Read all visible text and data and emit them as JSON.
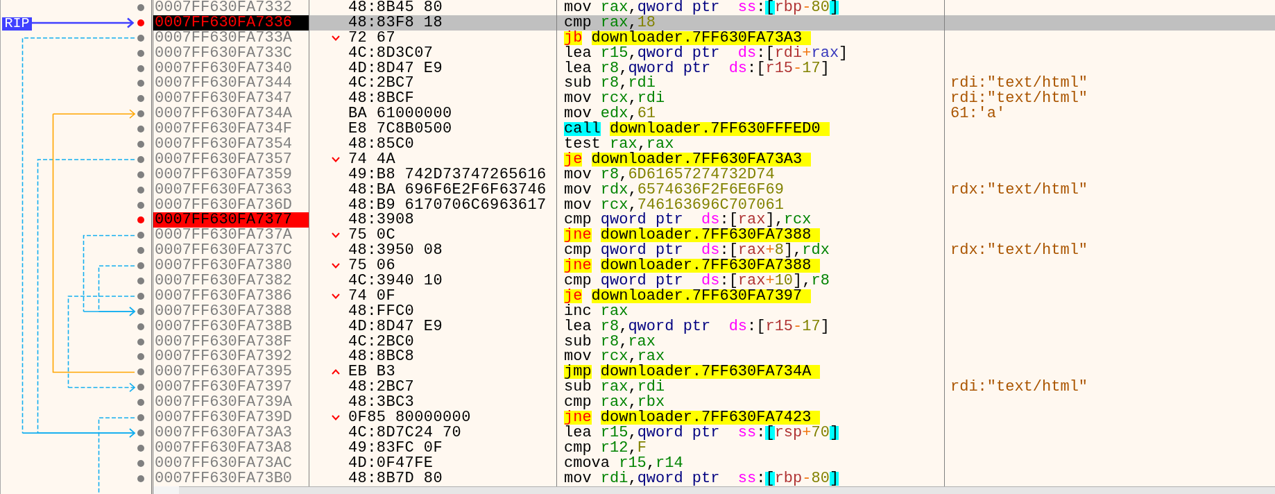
{
  "gutter": {
    "pointer_label": "RIP"
  },
  "rows": [
    {
      "kind": "plain",
      "address": "0007FF630FA7332",
      "breakpoint": false,
      "current": false,
      "selected": false,
      "bytes": "48:8B45 80",
      "mnemonic": {
        "kind": "plain",
        "text": "mov"
      },
      "operands": [
        {
          "kind": "reg",
          "text": "rax"
        },
        {
          "kind": "punct",
          "text": ","
        },
        {
          "kind": "size",
          "text": "qword ptr"
        },
        {
          "kind": "seg",
          "text": "ss"
        },
        {
          "kind": "punct",
          "text": ":"
        },
        {
          "kind": "stack-bracket",
          "text": "["
        },
        {
          "kind": "base",
          "text": "rbp"
        },
        {
          "kind": "op",
          "text": "-"
        },
        {
          "kind": "value",
          "text": "80"
        },
        {
          "kind": "stack-bracket",
          "text": "]"
        }
      ]
    },
    {
      "kind": "plain",
      "address": "0007FF630FA7336",
      "breakpoint": true,
      "current": true,
      "selected": true,
      "bytes": "48:83F8 18",
      "mnemonic": {
        "kind": "plain",
        "text": "cmp"
      },
      "operands": [
        {
          "kind": "reg",
          "text": "rax"
        },
        {
          "kind": "punct",
          "text": ","
        },
        {
          "kind": "value",
          "text": "18"
        }
      ]
    },
    {
      "kind": "branch-down",
      "address": "0007FF630FA733A",
      "breakpoint": false,
      "current": false,
      "selected": false,
      "bytes": "72 67",
      "mnemonic": {
        "kind": "cond-jump",
        "text": "jb"
      },
      "operands": [
        {
          "kind": "target",
          "text": "downloader.7FF630FA73A3"
        }
      ]
    },
    {
      "kind": "plain",
      "address": "0007FF630FA733C",
      "breakpoint": false,
      "current": false,
      "selected": false,
      "bytes": "4C:8D3C07",
      "mnemonic": {
        "kind": "plain",
        "text": "lea"
      },
      "operands": [
        {
          "kind": "reg",
          "text": "r15"
        },
        {
          "kind": "punct",
          "text": ","
        },
        {
          "kind": "size",
          "text": "qword ptr"
        },
        {
          "kind": "seg",
          "text": "ds"
        },
        {
          "kind": "punct",
          "text": ":"
        },
        {
          "kind": "bracket",
          "text": "["
        },
        {
          "kind": "base",
          "text": "rdi"
        },
        {
          "kind": "op",
          "text": "+"
        },
        {
          "kind": "index",
          "text": "rax"
        },
        {
          "kind": "bracket",
          "text": "]"
        }
      ]
    },
    {
      "kind": "plain",
      "address": "0007FF630FA7340",
      "breakpoint": false,
      "current": false,
      "selected": false,
      "bytes": "4D:8D47 E9",
      "mnemonic": {
        "kind": "plain",
        "text": "lea"
      },
      "operands": [
        {
          "kind": "reg",
          "text": "r8"
        },
        {
          "kind": "punct",
          "text": ","
        },
        {
          "kind": "size",
          "text": "qword ptr"
        },
        {
          "kind": "seg",
          "text": "ds"
        },
        {
          "kind": "punct",
          "text": ":"
        },
        {
          "kind": "bracket",
          "text": "["
        },
        {
          "kind": "base",
          "text": "r15"
        },
        {
          "kind": "op",
          "text": "-"
        },
        {
          "kind": "value",
          "text": "17"
        },
        {
          "kind": "bracket",
          "text": "]"
        }
      ]
    },
    {
      "kind": "plain",
      "address": "0007FF630FA7344",
      "breakpoint": false,
      "current": false,
      "selected": false,
      "bytes": "4C:2BC7",
      "mnemonic": {
        "kind": "plain",
        "text": "sub"
      },
      "operands": [
        {
          "kind": "reg",
          "text": "r8"
        },
        {
          "kind": "punct",
          "text": ","
        },
        {
          "kind": "reg",
          "text": "rdi"
        }
      ],
      "comment": "rdi:\"text/html\""
    },
    {
      "kind": "plain",
      "address": "0007FF630FA7347",
      "breakpoint": false,
      "current": false,
      "selected": false,
      "bytes": "48:8BCF",
      "mnemonic": {
        "kind": "plain",
        "text": "mov"
      },
      "operands": [
        {
          "kind": "reg",
          "text": "rcx"
        },
        {
          "kind": "punct",
          "text": ","
        },
        {
          "kind": "reg",
          "text": "rdi"
        }
      ],
      "comment": "rdi:\"text/html\""
    },
    {
      "kind": "plain",
      "address": "0007FF630FA734A",
      "breakpoint": false,
      "current": false,
      "selected": false,
      "bytes": "BA 61000000",
      "mnemonic": {
        "kind": "plain",
        "text": "mov"
      },
      "operands": [
        {
          "kind": "reg",
          "text": "edx"
        },
        {
          "kind": "punct",
          "text": ","
        },
        {
          "kind": "value",
          "text": "61"
        }
      ],
      "comment": "61:'a'"
    },
    {
      "kind": "plain",
      "address": "0007FF630FA734F",
      "breakpoint": false,
      "current": false,
      "selected": false,
      "bytes": "E8 7C8B0500",
      "mnemonic": {
        "kind": "call",
        "text": "call"
      },
      "operands": [
        {
          "kind": "target",
          "text": "downloader.7FF630FFFED0"
        }
      ]
    },
    {
      "kind": "plain",
      "address": "0007FF630FA7354",
      "breakpoint": false,
      "current": false,
      "selected": false,
      "bytes": "48:85C0",
      "mnemonic": {
        "kind": "plain",
        "text": "test"
      },
      "operands": [
        {
          "kind": "reg",
          "text": "rax"
        },
        {
          "kind": "punct",
          "text": ","
        },
        {
          "kind": "reg",
          "text": "rax"
        }
      ]
    },
    {
      "kind": "branch-down",
      "address": "0007FF630FA7357",
      "breakpoint": false,
      "current": false,
      "selected": false,
      "bytes": "74 4A",
      "mnemonic": {
        "kind": "cond-jump",
        "text": "je"
      },
      "operands": [
        {
          "kind": "target",
          "text": "downloader.7FF630FA73A3"
        }
      ]
    },
    {
      "kind": "plain",
      "address": "0007FF630FA7359",
      "breakpoint": false,
      "current": false,
      "selected": false,
      "bytes": "49:B8 742D73747265616",
      "mnemonic": {
        "kind": "plain",
        "text": "mov"
      },
      "operands": [
        {
          "kind": "reg",
          "text": "r8"
        },
        {
          "kind": "punct",
          "text": ","
        },
        {
          "kind": "value",
          "text": "6D61657274732D74"
        }
      ]
    },
    {
      "kind": "plain",
      "address": "0007FF630FA7363",
      "breakpoint": false,
      "current": false,
      "selected": false,
      "bytes": "48:BA 696F6E2F6F63746",
      "mnemonic": {
        "kind": "plain",
        "text": "mov"
      },
      "operands": [
        {
          "kind": "reg",
          "text": "rdx"
        },
        {
          "kind": "punct",
          "text": ","
        },
        {
          "kind": "value",
          "text": "6574636F2F6E6F69"
        }
      ],
      "comment": "rdx:\"text/html\""
    },
    {
      "kind": "plain",
      "address": "0007FF630FA736D",
      "breakpoint": false,
      "current": false,
      "selected": false,
      "bytes": "48:B9 6170706C6963617",
      "mnemonic": {
        "kind": "plain",
        "text": "mov"
      },
      "operands": [
        {
          "kind": "reg",
          "text": "rcx"
        },
        {
          "kind": "punct",
          "text": ","
        },
        {
          "kind": "value",
          "text": "746163696C707061"
        }
      ]
    },
    {
      "kind": "plain",
      "address": "0007FF630FA7377",
      "breakpoint": true,
      "current": false,
      "selected": false,
      "bytes": "48:3908",
      "mnemonic": {
        "kind": "plain",
        "text": "cmp"
      },
      "operands": [
        {
          "kind": "size",
          "text": "qword ptr"
        },
        {
          "kind": "seg",
          "text": "ds"
        },
        {
          "kind": "punct",
          "text": ":"
        },
        {
          "kind": "bracket",
          "text": "["
        },
        {
          "kind": "base",
          "text": "rax"
        },
        {
          "kind": "bracket",
          "text": "]"
        },
        {
          "kind": "punct",
          "text": ","
        },
        {
          "kind": "reg",
          "text": "rcx"
        }
      ]
    },
    {
      "kind": "branch-down",
      "address": "0007FF630FA737A",
      "breakpoint": false,
      "current": false,
      "selected": false,
      "bytes": "75 0C",
      "mnemonic": {
        "kind": "cond-jump",
        "text": "jne"
      },
      "operands": [
        {
          "kind": "target",
          "text": "downloader.7FF630FA7388"
        }
      ]
    },
    {
      "kind": "plain",
      "address": "0007FF630FA737C",
      "breakpoint": false,
      "current": false,
      "selected": false,
      "bytes": "48:3950 08",
      "mnemonic": {
        "kind": "plain",
        "text": "cmp"
      },
      "operands": [
        {
          "kind": "size",
          "text": "qword ptr"
        },
        {
          "kind": "seg",
          "text": "ds"
        },
        {
          "kind": "punct",
          "text": ":"
        },
        {
          "kind": "bracket",
          "text": "["
        },
        {
          "kind": "base",
          "text": "rax"
        },
        {
          "kind": "op",
          "text": "+"
        },
        {
          "kind": "value",
          "text": "8"
        },
        {
          "kind": "bracket",
          "text": "]"
        },
        {
          "kind": "punct",
          "text": ","
        },
        {
          "kind": "reg",
          "text": "rdx"
        }
      ],
      "comment": "rdx:\"text/html\""
    },
    {
      "kind": "branch-down",
      "address": "0007FF630FA7380",
      "breakpoint": false,
      "current": false,
      "selected": false,
      "bytes": "75 06",
      "mnemonic": {
        "kind": "cond-jump",
        "text": "jne"
      },
      "operands": [
        {
          "kind": "target",
          "text": "downloader.7FF630FA7388"
        }
      ]
    },
    {
      "kind": "plain",
      "address": "0007FF630FA7382",
      "breakpoint": false,
      "current": false,
      "selected": false,
      "bytes": "4C:3940 10",
      "mnemonic": {
        "kind": "plain",
        "text": "cmp"
      },
      "operands": [
        {
          "kind": "size",
          "text": "qword ptr"
        },
        {
          "kind": "seg",
          "text": "ds"
        },
        {
          "kind": "punct",
          "text": ":"
        },
        {
          "kind": "bracket",
          "text": "["
        },
        {
          "kind": "base",
          "text": "rax"
        },
        {
          "kind": "op",
          "text": "+"
        },
        {
          "kind": "value",
          "text": "10"
        },
        {
          "kind": "bracket",
          "text": "]"
        },
        {
          "kind": "punct",
          "text": ","
        },
        {
          "kind": "reg",
          "text": "r8"
        }
      ]
    },
    {
      "kind": "branch-down",
      "address": "0007FF630FA7386",
      "breakpoint": false,
      "current": false,
      "selected": false,
      "bytes": "74 0F",
      "mnemonic": {
        "kind": "cond-jump",
        "text": "je"
      },
      "operands": [
        {
          "kind": "target",
          "text": "downloader.7FF630FA7397"
        }
      ]
    },
    {
      "kind": "plain",
      "address": "0007FF630FA7388",
      "breakpoint": false,
      "current": false,
      "selected": false,
      "bytes": "48:FFC0",
      "mnemonic": {
        "kind": "plain",
        "text": "inc"
      },
      "operands": [
        {
          "kind": "reg",
          "text": "rax"
        }
      ]
    },
    {
      "kind": "plain",
      "address": "0007FF630FA738B",
      "breakpoint": false,
      "current": false,
      "selected": false,
      "bytes": "4D:8D47 E9",
      "mnemonic": {
        "kind": "plain",
        "text": "lea"
      },
      "operands": [
        {
          "kind": "reg",
          "text": "r8"
        },
        {
          "kind": "punct",
          "text": ","
        },
        {
          "kind": "size",
          "text": "qword ptr"
        },
        {
          "kind": "seg",
          "text": "ds"
        },
        {
          "kind": "punct",
          "text": ":"
        },
        {
          "kind": "bracket",
          "text": "["
        },
        {
          "kind": "base",
          "text": "r15"
        },
        {
          "kind": "op",
          "text": "-"
        },
        {
          "kind": "value",
          "text": "17"
        },
        {
          "kind": "bracket",
          "text": "]"
        }
      ]
    },
    {
      "kind": "plain",
      "address": "0007FF630FA738F",
      "breakpoint": false,
      "current": false,
      "selected": false,
      "bytes": "4C:2BC0",
      "mnemonic": {
        "kind": "plain",
        "text": "sub"
      },
      "operands": [
        {
          "kind": "reg",
          "text": "r8"
        },
        {
          "kind": "punct",
          "text": ","
        },
        {
          "kind": "reg",
          "text": "rax"
        }
      ]
    },
    {
      "kind": "plain",
      "address": "0007FF630FA7392",
      "breakpoint": false,
      "current": false,
      "selected": false,
      "bytes": "48:8BC8",
      "mnemonic": {
        "kind": "plain",
        "text": "mov"
      },
      "operands": [
        {
          "kind": "reg",
          "text": "rcx"
        },
        {
          "kind": "punct",
          "text": ","
        },
        {
          "kind": "reg",
          "text": "rax"
        }
      ]
    },
    {
      "kind": "branch-up",
      "address": "0007FF630FA7395",
      "breakpoint": false,
      "current": false,
      "selected": false,
      "bytes": "EB B3",
      "mnemonic": {
        "kind": "jump",
        "text": "jmp"
      },
      "operands": [
        {
          "kind": "target",
          "text": "downloader.7FF630FA734A"
        }
      ]
    },
    {
      "kind": "plain",
      "address": "0007FF630FA7397",
      "breakpoint": false,
      "current": false,
      "selected": false,
      "bytes": "48:2BC7",
      "mnemonic": {
        "kind": "plain",
        "text": "sub"
      },
      "operands": [
        {
          "kind": "reg",
          "text": "rax"
        },
        {
          "kind": "punct",
          "text": ","
        },
        {
          "kind": "reg",
          "text": "rdi"
        }
      ],
      "comment": "rdi:\"text/html\""
    },
    {
      "kind": "plain",
      "address": "0007FF630FA739A",
      "breakpoint": false,
      "current": false,
      "selected": false,
      "bytes": "48:3BC3",
      "mnemonic": {
        "kind": "plain",
        "text": "cmp"
      },
      "operands": [
        {
          "kind": "reg",
          "text": "rax"
        },
        {
          "kind": "punct",
          "text": ","
        },
        {
          "kind": "reg",
          "text": "rbx"
        }
      ]
    },
    {
      "kind": "branch-down",
      "address": "0007FF630FA739D",
      "breakpoint": false,
      "current": false,
      "selected": false,
      "bytes": "0F85 80000000",
      "mnemonic": {
        "kind": "cond-jump",
        "text": "jne"
      },
      "operands": [
        {
          "kind": "target",
          "text": "downloader.7FF630FA7423"
        }
      ]
    },
    {
      "kind": "plain",
      "address": "0007FF630FA73A3",
      "breakpoint": false,
      "current": false,
      "selected": false,
      "bytes": "4C:8D7C24 70",
      "mnemonic": {
        "kind": "plain",
        "text": "lea"
      },
      "operands": [
        {
          "kind": "reg",
          "text": "r15"
        },
        {
          "kind": "punct",
          "text": ","
        },
        {
          "kind": "size",
          "text": "qword ptr"
        },
        {
          "kind": "seg",
          "text": "ss"
        },
        {
          "kind": "punct",
          "text": ":"
        },
        {
          "kind": "stack-bracket",
          "text": "["
        },
        {
          "kind": "base",
          "text": "rsp"
        },
        {
          "kind": "op",
          "text": "+"
        },
        {
          "kind": "value",
          "text": "70"
        },
        {
          "kind": "stack-bracket",
          "text": "]"
        }
      ]
    },
    {
      "kind": "plain",
      "address": "0007FF630FA73A8",
      "breakpoint": false,
      "current": false,
      "selected": false,
      "bytes": "49:83FC 0F",
      "mnemonic": {
        "kind": "plain",
        "text": "cmp"
      },
      "operands": [
        {
          "kind": "reg",
          "text": "r12"
        },
        {
          "kind": "punct",
          "text": ","
        },
        {
          "kind": "value",
          "text": "F"
        }
      ]
    },
    {
      "kind": "plain",
      "address": "0007FF630FA73AC",
      "breakpoint": false,
      "current": false,
      "selected": false,
      "bytes": "4D:0F47FE",
      "mnemonic": {
        "kind": "plain",
        "text": "cmova"
      },
      "operands": [
        {
          "kind": "reg",
          "text": "r15"
        },
        {
          "kind": "punct",
          "text": ","
        },
        {
          "kind": "reg",
          "text": "r14"
        }
      ]
    },
    {
      "kind": "plain",
      "address": "0007FF630FA73B0",
      "breakpoint": false,
      "current": false,
      "selected": false,
      "bytes": "48:8B7D 80",
      "mnemonic": {
        "kind": "plain",
        "text": "mov"
      },
      "operands": [
        {
          "kind": "reg",
          "text": "rdi"
        },
        {
          "kind": "punct",
          "text": ","
        },
        {
          "kind": "size",
          "text": "qword ptr"
        },
        {
          "kind": "seg",
          "text": "ss"
        },
        {
          "kind": "punct",
          "text": ":"
        },
        {
          "kind": "stack-bracket",
          "text": "["
        },
        {
          "kind": "base",
          "text": "rbp"
        },
        {
          "kind": "op",
          "text": "-"
        },
        {
          "kind": "value",
          "text": "80"
        },
        {
          "kind": "stack-bracket",
          "text": "]"
        }
      ]
    }
  ]
}
